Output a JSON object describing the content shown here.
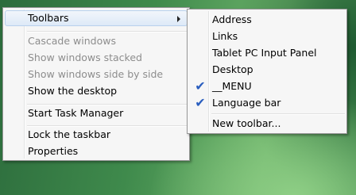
{
  "context_menu": {
    "items": [
      {
        "label": "Toolbars",
        "disabled": false,
        "submenu": true
      },
      {
        "label": "Cascade windows",
        "disabled": true
      },
      {
        "label": "Show windows stacked",
        "disabled": true
      },
      {
        "label": "Show windows side by side",
        "disabled": true
      },
      {
        "label": "Show the desktop",
        "disabled": false
      },
      {
        "label": "Start Task Manager",
        "disabled": false
      },
      {
        "label": "Lock the taskbar",
        "disabled": false
      },
      {
        "label": "Properties",
        "disabled": false
      }
    ]
  },
  "toolbars_submenu": {
    "items": [
      {
        "label": "Address",
        "checked": false
      },
      {
        "label": "Links",
        "checked": false
      },
      {
        "label": "Tablet PC Input Panel",
        "checked": false
      },
      {
        "label": "Desktop",
        "checked": false
      },
      {
        "label": "__MENU",
        "checked": true
      },
      {
        "label": "Language bar",
        "checked": true
      },
      {
        "label": "New toolbar...",
        "checked": false
      }
    ],
    "check_glyph": "✔"
  },
  "colors": {
    "menu_background": "#f6f6f6",
    "disabled_text": "#8d8d8d",
    "check_color": "#2a5ebf",
    "hover_border": "#b8d0ec"
  }
}
